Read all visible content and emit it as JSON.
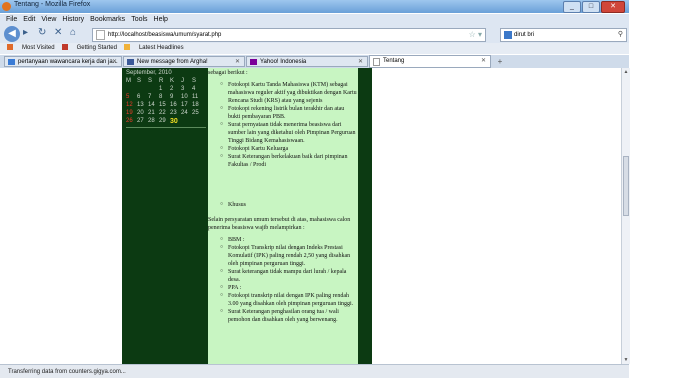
{
  "window": {
    "title": "Tentang - Mozilla Firefox"
  },
  "menu": [
    "File",
    "Edit",
    "View",
    "History",
    "Bookmarks",
    "Tools",
    "Help"
  ],
  "nav": {
    "url": "http://localhost/beasiswa/umum/syarat.php",
    "search": "dirut bri"
  },
  "bookmarks": [
    "Most Visited",
    "Getting Started",
    "Latest Headlines"
  ],
  "tabs": [
    {
      "label": "pertanyaan wawancara kerja dan ja..."
    },
    {
      "label": "New message from Argha!"
    },
    {
      "label": "Yahoo! Indonesia"
    },
    {
      "label": "Tentang"
    }
  ],
  "calendar": {
    "month": "September, 2010",
    "days": [
      "M",
      "S",
      "S",
      "R",
      "K",
      "J",
      "S"
    ],
    "weeks": [
      [
        "",
        "",
        "",
        "1",
        "2",
        "3",
        "4"
      ],
      [
        "5",
        "6",
        "7",
        "8",
        "9",
        "10",
        "11"
      ],
      [
        "12",
        "13",
        "14",
        "15",
        "16",
        "17",
        "18"
      ],
      [
        "19",
        "20",
        "21",
        "22",
        "23",
        "24",
        "25"
      ],
      [
        "26",
        "27",
        "28",
        "29",
        "30",
        "",
        ""
      ]
    ]
  },
  "content": {
    "intro": "sebagai berikut :",
    "list1": [
      "Fotokopi Kartu Tanda Mahasiswa (KTM) sebagai mahasiswa reguler aktif yag dibuktikan dengan Kartu Rencana Studi (KRS) atau yang sejenis",
      "Fotokopi rekening listrik bulan terakhir dan atau bukti pembayaran PBB.",
      "Surat pernyataan tidak menerima beasiswa dari sumber lain yang diketahui oleh Pimpinan Perguruan Tinggi Bidang Kemahasiswaan.",
      "Fotokopi Kartu Keluarga",
      "Surat Keterangan berkelakuan baik dari pimpinan Fakultas / Prodi"
    ],
    "khusus": "Khusus",
    "para2": "Selain persyaratan umum tersebut di atas, mahasiswa calon penerima beasiswa wajib melampirkan :",
    "list2": [
      "BBM :",
      "Fotokopi Transkrip nilai dengan Indeks Prestasi Komulatif (IPK) paling rendah 2,50 yang disahkan oleh pimpinan perguruan tinggi.",
      "Surat keterangan tidak mampu dari lurah / kepala desa.",
      "PPA :",
      "Fotokopi transkrip nilai dengan IPK paling rendah 3.00 yang disahkan oleh pimpinan perguruan tinggi.",
      "Surat Keterangan penghasilan orang tua / wali pemohon dan disahkan oleh yang berwenang."
    ]
  },
  "status": "Transferring data from counters.gigya.com..."
}
